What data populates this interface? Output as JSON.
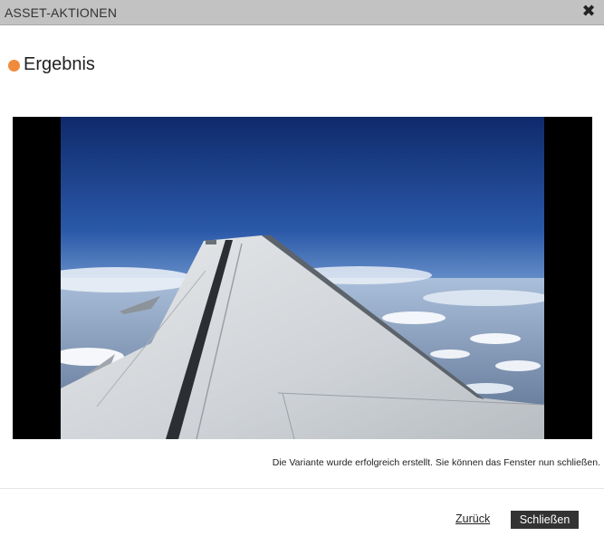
{
  "dialog": {
    "title": "ASSET-AKTIONEN",
    "close_icon": "close-icon"
  },
  "section": {
    "title": "Ergebnis",
    "accent_color": "#f08a3c"
  },
  "preview": {
    "subject": "airplane-wing-photo"
  },
  "status_message": "Die Variante wurde erfolgreich erstellt. Sie können das Fenster nun schließen.",
  "footer": {
    "back_label": "Zurück",
    "close_label": "Schließen"
  }
}
